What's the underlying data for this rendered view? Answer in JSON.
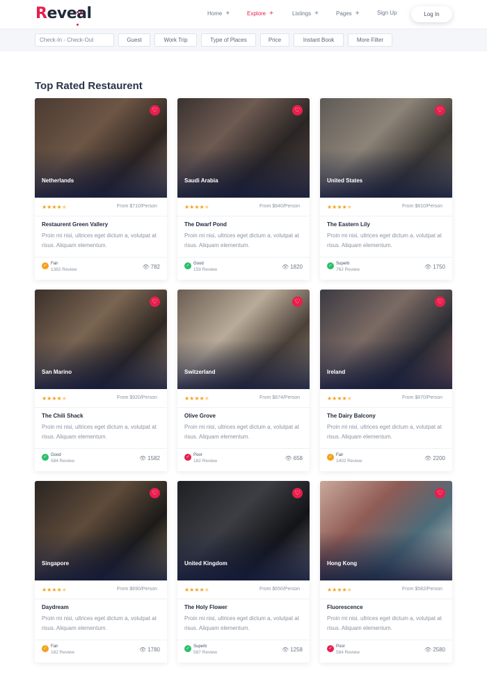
{
  "brand": {
    "logo": "Reveal",
    "accent": "#e91e4d"
  },
  "nav": [
    {
      "label": "Home",
      "plus": "+"
    },
    {
      "label": "Explore",
      "plus": "+"
    },
    {
      "label": "Listings",
      "plus": "+"
    },
    {
      "label": "Pages",
      "plus": "+"
    },
    {
      "label": "Sign Up"
    }
  ],
  "login_label": "Log In",
  "filters": {
    "date_placeholder": "Check-In - Check-Out",
    "buttons": [
      "Guest",
      "Work Trip",
      "Type of Places",
      "Price",
      "Instant Book",
      "More Filter"
    ]
  },
  "section_title": "Top Rated Restaurent",
  "cards": [
    {
      "location": "Netherlands",
      "stars": "★★★★",
      "half": "★",
      "price": "From $710/Person",
      "name": "Restaurent Green Vallery",
      "desc": "Proin mi nisi, ultrices eget dictum a, volutpat at risus. Aliquam elementum.",
      "rating": "Fair",
      "reviews": "1382 Review",
      "views": "782",
      "badge_color": "#f4a11e"
    },
    {
      "location": "Saudi Arabia",
      "stars": "★★★★",
      "half": "★",
      "price": "From $840/Person",
      "name": "The Dwarf Pond",
      "desc": "Proin mi nisi, ultrices eget dictum a, volutpat at risus. Aliquam elementum.",
      "rating": "Good",
      "reviews": "159 Review",
      "views": "1820",
      "badge_color": "#2bbf6a"
    },
    {
      "location": "United States",
      "stars": "★★★★",
      "half": "★",
      "price": "From $810/Person",
      "name": "The Eastern Lily",
      "desc": "Proin mi nisi, ultrices eget dictum a, volutpat at risus. Aliquam elementum.",
      "rating": "Superb",
      "reviews": "762 Review",
      "views": "1750",
      "badge_color": "#2bbf6a"
    },
    {
      "location": "San Marino",
      "stars": "★★★★",
      "half": "★",
      "price": "From $920/Person",
      "name": "The Chili Shack",
      "desc": "Proin mi nisi, ultrices eget dictum a, volutpat at risus. Aliquam elementum.",
      "rating": "Good",
      "reviews": "584 Review",
      "views": "1582",
      "badge_color": "#2bbf6a"
    },
    {
      "location": "Switzerland",
      "stars": "★★★★",
      "half": "★",
      "price": "From $874/Person",
      "name": "Olive Grove",
      "desc": "Proin mi nisi, ultrices eget dictum a, volutpat at risus. Aliquam elementum.",
      "rating": "Poor",
      "reviews": "182 Review",
      "views": "658",
      "badge_color": "#e91e4d"
    },
    {
      "location": "Ireland",
      "stars": "★★★★",
      "half": "★",
      "price": "From $870/Person",
      "name": "The Dairy Balcony",
      "desc": "Proin mi nisi, ultrices eget dictum a, volutpat at risus. Aliquam elementum.",
      "rating": "Fair",
      "reviews": "1402 Review",
      "views": "2200",
      "badge_color": "#f4a11e"
    },
    {
      "location": "Singapore",
      "stars": "★★★★",
      "half": "★",
      "price": "From $690/Person",
      "name": "Daydream",
      "desc": "Proin mi nisi, ultrices eget dictum a, volutpat at risus. Aliquam elementum.",
      "rating": "Fair",
      "reviews": "182 Review",
      "views": "1780",
      "badge_color": "#f4a11e"
    },
    {
      "location": "United Kingdom",
      "stars": "★★★★",
      "half": "★",
      "price": "From $650/Person",
      "name": "The Holy Flower",
      "desc": "Proin mi nisi, ultrices eget dictum a, volutpat at risus. Aliquam elementum.",
      "rating": "Superb",
      "reviews": "587 Review",
      "views": "1258",
      "badge_color": "#2bbf6a"
    },
    {
      "location": "Hong Kong",
      "stars": "★★★★",
      "half": "★",
      "price": "From $582/Person",
      "name": "Fluorescence",
      "desc": "Proin mi nisi, ultrices eget dictum a, volutpat at risus. Aliquam elementum.",
      "rating": "Poor",
      "reviews": "584 Review",
      "views": "2580",
      "badge_color": "#e91e4d"
    }
  ]
}
